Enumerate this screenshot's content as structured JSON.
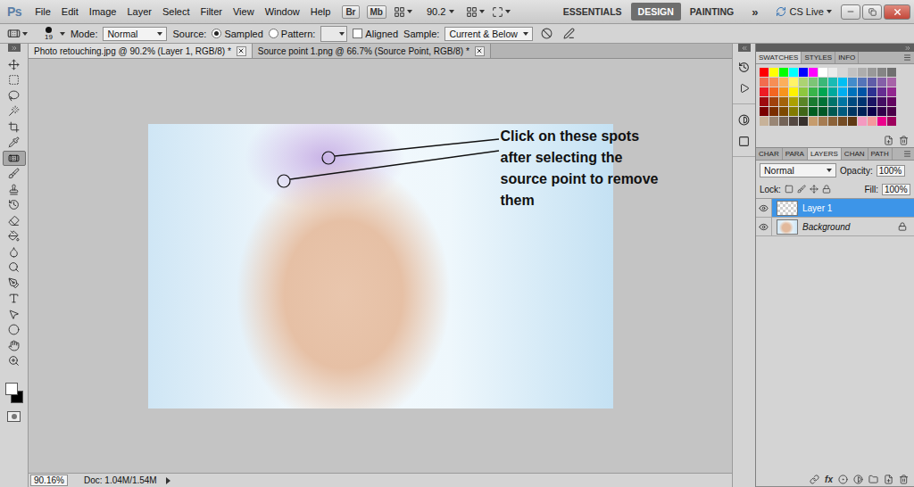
{
  "app": {
    "logo": "Ps",
    "menus": [
      "File",
      "Edit",
      "Image",
      "Layer",
      "Select",
      "Filter",
      "View",
      "Window",
      "Help"
    ],
    "bridge": "Br",
    "mini_bridge": "Mb",
    "zoom": "90.2",
    "workspaces": [
      {
        "label": "ESSENTIALS",
        "selected": false
      },
      {
        "label": "DESIGN",
        "selected": true
      },
      {
        "label": "PAINTING",
        "selected": false
      }
    ],
    "more": "»",
    "cs_live": "CS Live"
  },
  "options_bar": {
    "brush_size": "19",
    "mode_label": "Mode:",
    "mode": "Normal",
    "source_label": "Source:",
    "sources": [
      {
        "label": "Sampled",
        "selected": true
      },
      {
        "label": "Pattern:",
        "selected": false
      }
    ],
    "aligned": {
      "label": "Aligned",
      "checked": false
    },
    "sample_label": "Sample:",
    "sample": "Current & Below"
  },
  "documents": [
    {
      "label": "Photo retouching.jpg @ 90.2% (Layer 1, RGB/8) *",
      "selected": true
    },
    {
      "label": "Source point 1.png @ 66.7% (Source Point, RGB/8) *",
      "selected": false
    }
  ],
  "tools": [
    {
      "selected": false
    },
    {
      "selected": false
    },
    {
      "selected": false
    },
    {
      "selected": false
    },
    {
      "selected": false
    },
    {
      "selected": false
    },
    {
      "selected": true
    },
    {
      "selected": false
    },
    {
      "selected": false
    },
    {
      "selected": false
    },
    {
      "selected": false
    },
    {
      "selected": false
    },
    {
      "selected": false
    },
    {
      "selected": false
    },
    {
      "selected": false
    },
    {
      "selected": false
    },
    {
      "selected": false
    },
    {
      "selected": false
    },
    {
      "selected": false
    },
    {
      "selected": false
    }
  ],
  "colors": {
    "foreground": "#ffffff",
    "background": "#000000"
  },
  "canvas": {
    "annotation": "Click on these spots after selecting the source point to remove them"
  },
  "status_bar": {
    "zoom": "90.16%",
    "doc": "Doc: 1.04M/1.54M"
  },
  "swatches_panel": {
    "tabs": [
      {
        "label": "SWATCHES",
        "selected": true
      },
      {
        "label": "STYLES",
        "selected": false
      },
      {
        "label": "INFO",
        "selected": false
      }
    ],
    "swatches": [
      "#ff0000",
      "#ffff00",
      "#00ff00",
      "#00ffff",
      "#0000ff",
      "#ff00ff",
      "#ffffff",
      "#ebebeb",
      "#d6d6d6",
      "#c2c2c2",
      "#adadad",
      "#999999",
      "#858585",
      "#707070",
      "#f26c4f",
      "#f68e55",
      "#fbaf5c",
      "#fff467",
      "#acd372",
      "#7cc576",
      "#3bb878",
      "#1abbb4",
      "#00bff3",
      "#438ccb",
      "#5574b9",
      "#605ca8",
      "#855fa8",
      "#a763a8",
      "#ed1c24",
      "#f26522",
      "#f7941d",
      "#fff200",
      "#8dc73f",
      "#39b54a",
      "#00a651",
      "#00a99d",
      "#00aeef",
      "#0072bc",
      "#0054a6",
      "#2e3192",
      "#662d91",
      "#92278f",
      "#9e0b0f",
      "#a0410d",
      "#a36209",
      "#aba000",
      "#598527",
      "#197b30",
      "#007236",
      "#00746b",
      "#0076a3",
      "#004a80",
      "#003471",
      "#1b1464",
      "#440e62",
      "#630460",
      "#790000",
      "#7b2e00",
      "#7d4900",
      "#827b00",
      "#406618",
      "#005e20",
      "#005826",
      "#005952",
      "#005b7f",
      "#003663",
      "#002157",
      "#0d004c",
      "#32004b",
      "#4b0049",
      "#c7b299",
      "#998675",
      "#736357",
      "#534741",
      "#37302d",
      "#c69c6d",
      "#a67c52",
      "#8c6239",
      "#754c24",
      "#603913",
      "#f49ac1",
      "#f5989d",
      "#ec008c",
      "#9e005d"
    ]
  },
  "layers_panel": {
    "tabs": [
      {
        "label": "CHAR",
        "selected": false
      },
      {
        "label": "PARA",
        "selected": false
      },
      {
        "label": "LAYERS",
        "selected": true
      },
      {
        "label": "CHAN",
        "selected": false
      },
      {
        "label": "PATH",
        "selected": false
      }
    ],
    "blend_mode": "Normal",
    "opacity_label": "Opacity:",
    "opacity": "100%",
    "lock_label": "Lock:",
    "fill_label": "Fill:",
    "fill": "100%",
    "effects_label": "fx",
    "layers": [
      {
        "name": "Layer 1",
        "selected": true,
        "visible": true,
        "locked": false,
        "kind": "transparent"
      },
      {
        "name": "Background",
        "selected": false,
        "visible": true,
        "locked": true,
        "kind": "photo"
      }
    ]
  }
}
